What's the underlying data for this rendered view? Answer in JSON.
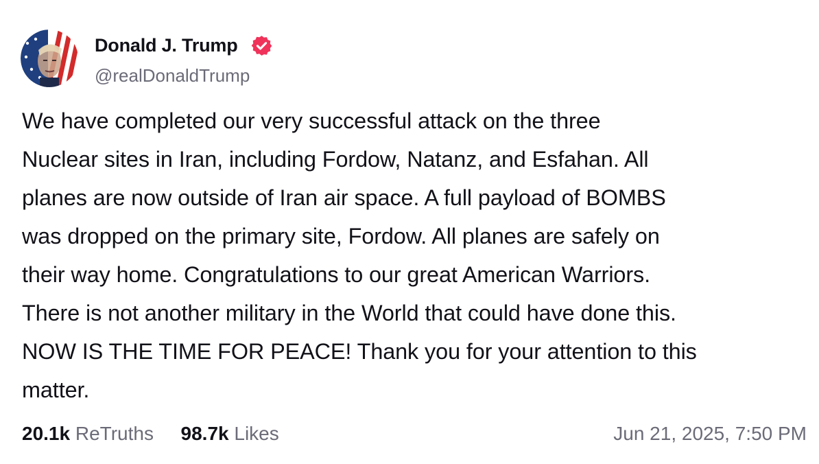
{
  "author": {
    "name": "Donald J. Trump",
    "handle": "@realDonaldTrump",
    "verified": true,
    "verified_color": "#f0335a"
  },
  "post": {
    "lines": [
      "We have completed our very successful attack on the three",
      "Nuclear sites in Iran, including Fordow, Natanz, and Esfahan. All",
      "planes are now outside of Iran air space. A full payload of BOMBS",
      "was dropped on the primary site, Fordow. All planes are safely on",
      "their way home. Congratulations to our great American Warriors.",
      "There is not another military in the World that could have done this.",
      "NOW IS THE TIME FOR PEACE! Thank you for your attention to this",
      "matter."
    ]
  },
  "stats": {
    "retruths_count": "20.1k",
    "retruths_label": "ReTruths",
    "likes_count": "98.7k",
    "likes_label": "Likes"
  },
  "timestamp": "Jun 21, 2025, 7:50 PM",
  "colors": {
    "text": "#111118",
    "muted": "#6b6b78",
    "background": "#ffffff"
  },
  "icons": {
    "avatar": "avatar-flag-portrait",
    "verified": "verified-badge-icon"
  }
}
